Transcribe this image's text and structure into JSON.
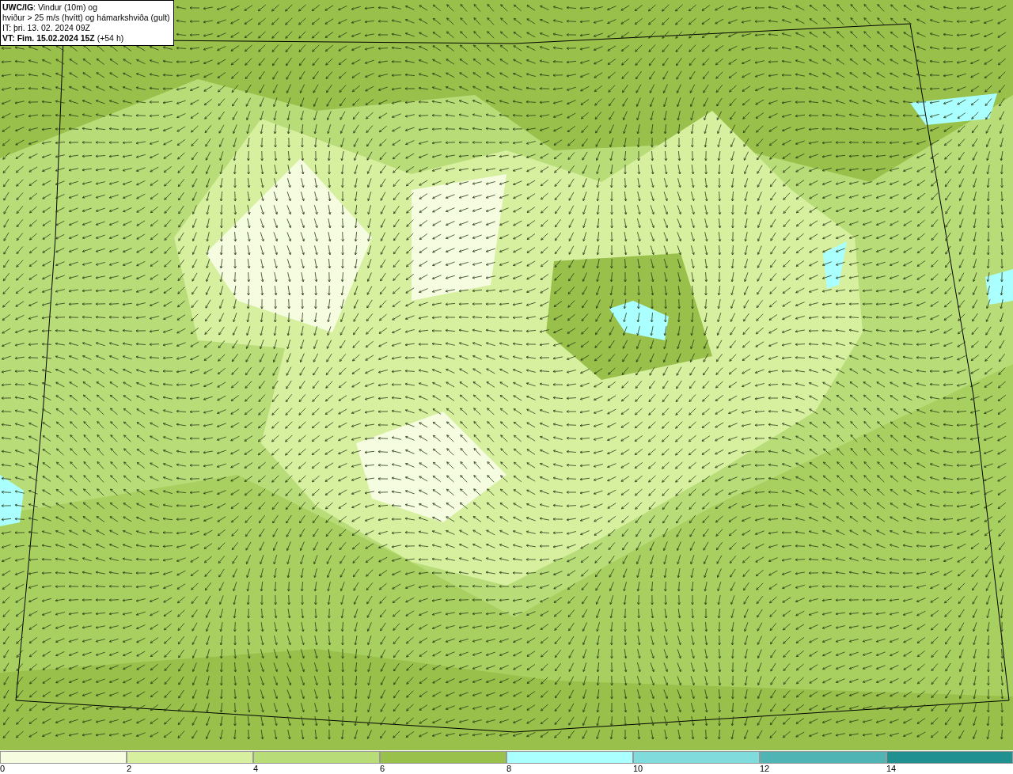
{
  "info": {
    "lines": [
      "**UWC/IG**: Vindur (10m) og",
      "hviður > 25 m/s (hvítt) og hámarkshviða (gult)",
      "IT: þri. 13. 02. 2024 09Z",
      "**VT: Fim. 15.02.2024 15Z** (+54 h)"
    ]
  },
  "legend": {
    "bins": [
      {
        "color": "#f5fce0"
      },
      {
        "color": "#d7f0a0"
      },
      {
        "color": "#b8dc78"
      },
      {
        "color": "#98c04a"
      },
      {
        "color": "#aaffff"
      },
      {
        "color": "#80dcdc"
      },
      {
        "color": "#50b4b4"
      },
      {
        "color": "#209090"
      }
    ],
    "ticks": [
      "0",
      "2",
      "4",
      "6",
      "8",
      "10",
      "12",
      "14"
    ]
  }
}
